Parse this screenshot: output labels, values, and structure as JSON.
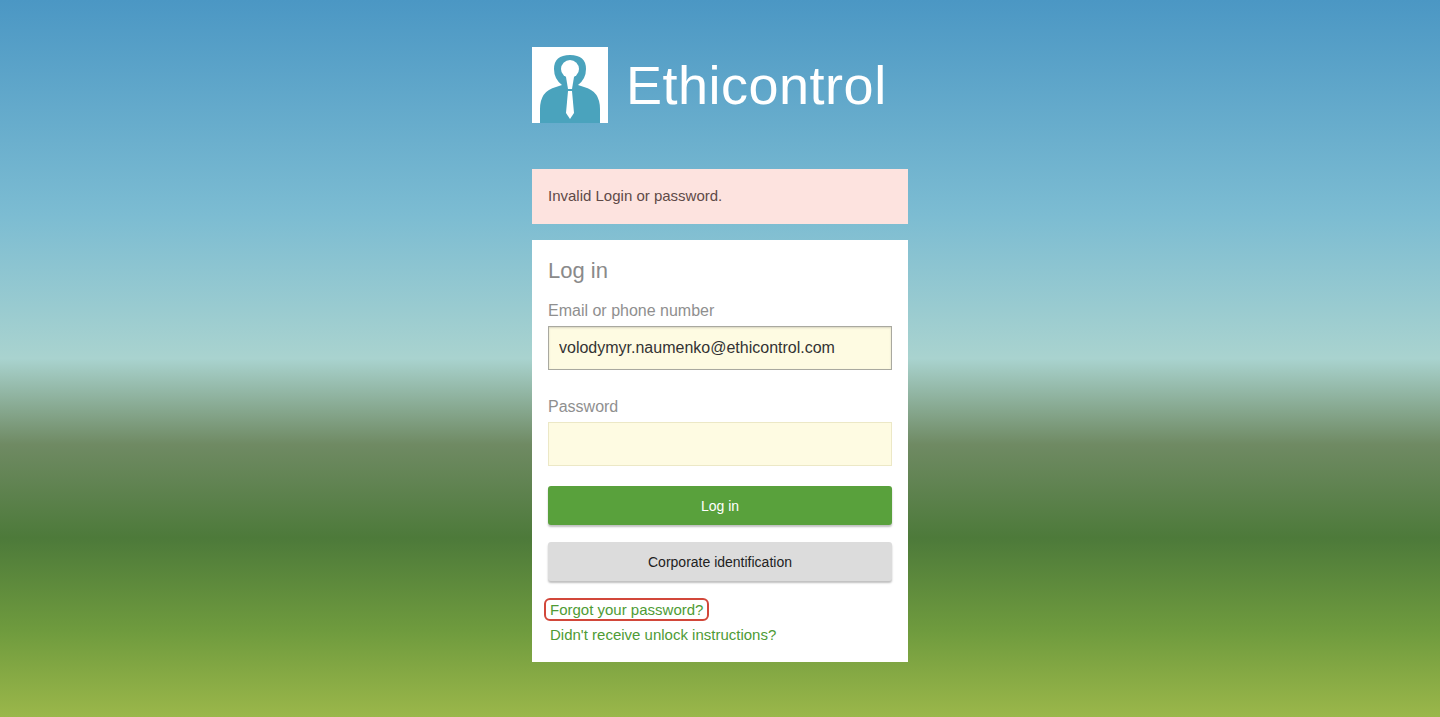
{
  "logo": {
    "text": "Ethicontrol"
  },
  "alert": {
    "text": "Invalid Login or password."
  },
  "form": {
    "title": "Log in",
    "fields": [
      {
        "label": "Email or phone number",
        "value": "volodymyr.naumenko@ethicontrol.com",
        "type": "text",
        "focused": true
      },
      {
        "label": "Password",
        "value": "",
        "type": "password",
        "focused": false
      }
    ],
    "buttons": [
      {
        "label": "Log in",
        "kind": "primary"
      },
      {
        "label": "Corporate identification",
        "kind": "secondary"
      }
    ],
    "links": [
      {
        "label": "Forgot your password?",
        "highlighted": true
      },
      {
        "label": "Didn't receive unlock instructions?",
        "highlighted": false
      }
    ]
  }
}
